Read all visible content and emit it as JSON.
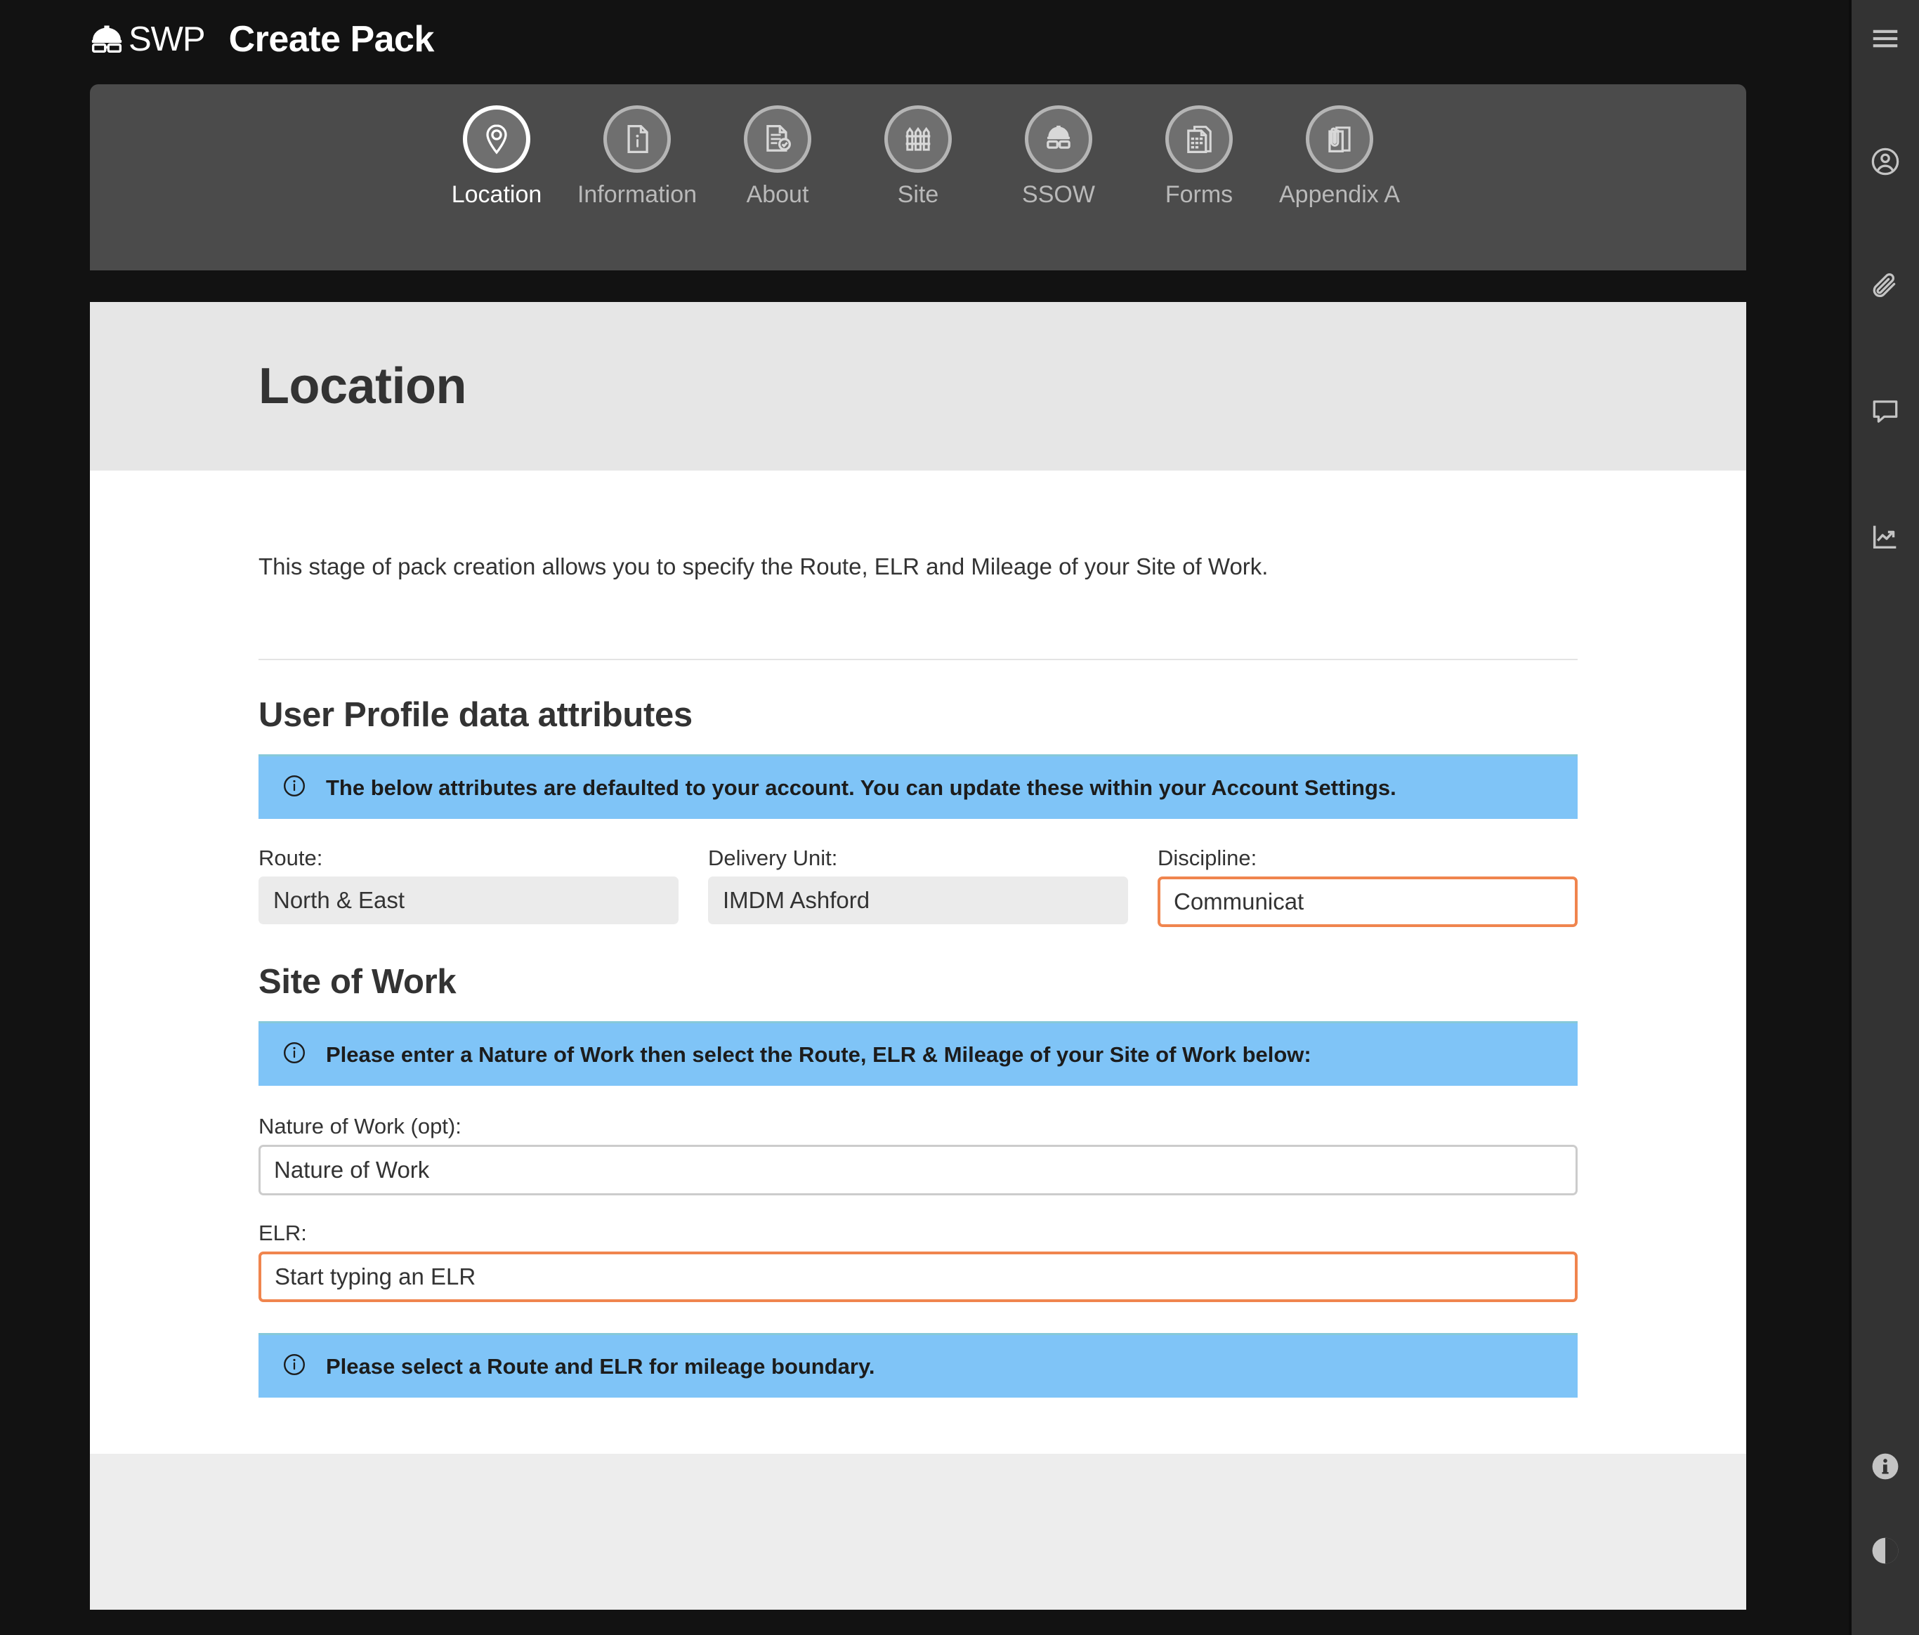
{
  "header": {
    "brand_text": "SWP",
    "brand_icon": "hardhat-icon",
    "title": "Create Pack"
  },
  "stepnav": {
    "steps": [
      {
        "label": "Location",
        "icon": "map-pin-icon",
        "active": true
      },
      {
        "label": "Information",
        "icon": "document-info-icon",
        "active": false
      },
      {
        "label": "About",
        "icon": "document-check-icon",
        "active": false
      },
      {
        "label": "Site",
        "icon": "fence-icon",
        "active": false
      },
      {
        "label": "SSOW",
        "icon": "ppe-icon",
        "active": false
      },
      {
        "label": "Forms",
        "icon": "forms-icon",
        "active": false
      },
      {
        "label": "Appendix A",
        "icon": "clipboard-clip-icon",
        "active": false
      }
    ]
  },
  "page": {
    "title": "Location",
    "intro": "This stage of pack creation allows you to specify the Route, ELR and Mileage of your Site of Work."
  },
  "user_profile": {
    "heading": "User Profile data attributes",
    "banner": "The below attributes are defaulted to your account. You can update these within your Account Settings.",
    "route_label": "Route:",
    "route_value": "North & East",
    "delivery_unit_label": "Delivery Unit:",
    "delivery_unit_value": "IMDM Ashford",
    "discipline_label": "Discipline:",
    "discipline_value": "Communicat"
  },
  "site_of_work": {
    "heading": "Site of Work",
    "banner": "Please enter a Nature of Work then select the Route, ELR & Mileage of your Site of Work below:",
    "nature_label": "Nature of Work (opt):",
    "nature_placeholder": "Nature of Work",
    "elr_label": "ELR:",
    "elr_placeholder": "Start typing an ELR",
    "mileage_banner": "Please select a Route and ELR for mileage boundary."
  },
  "sidebar": {
    "items": [
      {
        "icon": "hamburger-menu-icon"
      },
      {
        "icon": "user-account-icon"
      },
      {
        "icon": "paperclip-icon"
      },
      {
        "icon": "comment-icon"
      },
      {
        "icon": "analytics-chart-icon"
      }
    ],
    "bottom_items": [
      {
        "icon": "info-filled-icon"
      },
      {
        "icon": "contrast-toggle-icon"
      }
    ]
  },
  "colors": {
    "background": "#121212",
    "nav_panel": "#4b4b4b",
    "card_header": "#e6e6e6",
    "card_footer": "#ededed",
    "info_banner": "#7fc4f7",
    "highlight_border": "#f0854e",
    "sidebar": "#333333",
    "readonly_field": "#ebebeb"
  }
}
